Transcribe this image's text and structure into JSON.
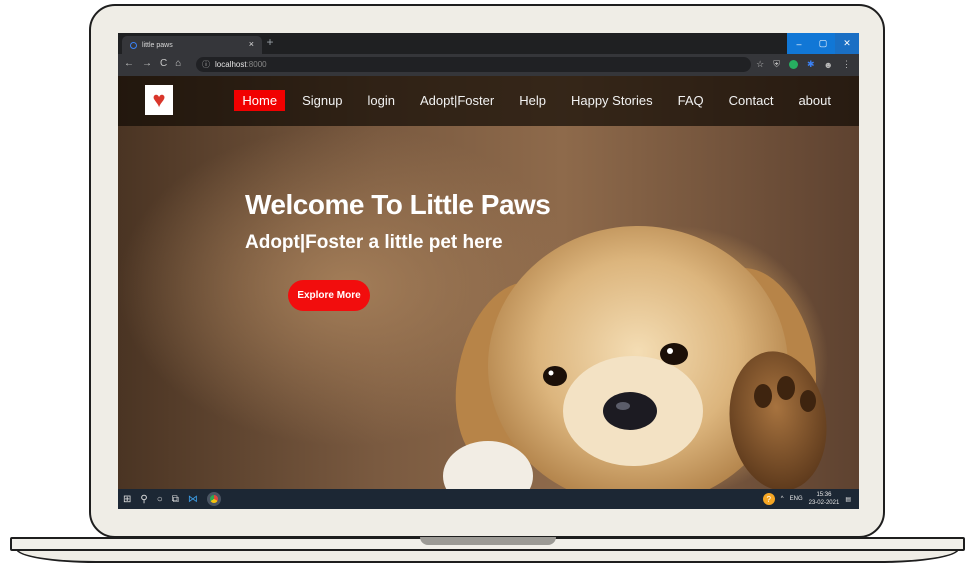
{
  "browser": {
    "tab_title": "little paws",
    "tab_close": "×",
    "new_tab": "+",
    "url_host": "localhost",
    "url_port": ":8000",
    "window_buttons": [
      "–",
      "▢",
      "✕"
    ]
  },
  "nav": {
    "items": [
      {
        "label": "Home",
        "active": true
      },
      {
        "label": "Signup"
      },
      {
        "label": "login"
      },
      {
        "label": "Adopt|Foster"
      },
      {
        "label": "Help"
      },
      {
        "label": "Happy Stories"
      },
      {
        "label": "FAQ"
      },
      {
        "label": "Contact"
      },
      {
        "label": "about"
      }
    ]
  },
  "hero": {
    "title": "Welcome To Little Paws",
    "subtitle": "Adopt|Foster a little pet here",
    "button": "Explore More"
  },
  "taskbar": {
    "language": "ENG",
    "time": "15:36",
    "date": "23-02-2021"
  },
  "colors": {
    "accent": "#f10000",
    "navbar": "#140c06"
  }
}
